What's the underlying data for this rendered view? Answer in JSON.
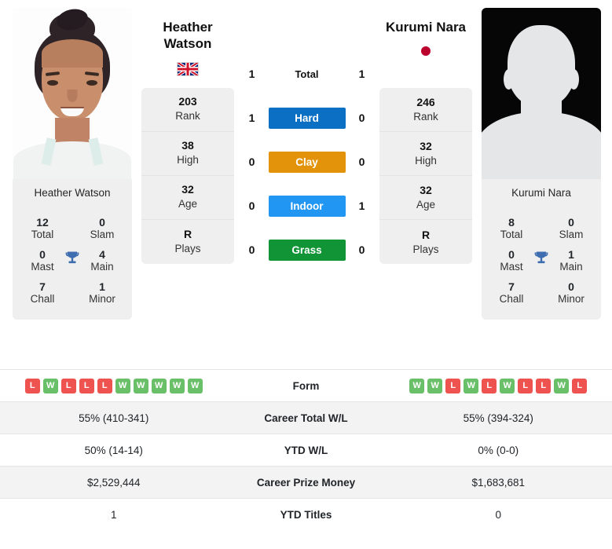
{
  "players": {
    "left": {
      "name": "Heather Watson",
      "name_line1": "Heather",
      "name_line2": "Watson",
      "photo_caption": "Heather Watson",
      "flag": "gb-flag-icon",
      "flag_country": "Great Britain",
      "stats": [
        {
          "value": "203",
          "label": "Rank"
        },
        {
          "value": "38",
          "label": "High"
        },
        {
          "value": "32",
          "label": "Age"
        },
        {
          "value": "R",
          "label": "Plays"
        }
      ],
      "titles": {
        "total": "12",
        "total_label": "Total",
        "slam": "0",
        "slam_label": "Slam",
        "mast": "0",
        "mast_label": "Mast",
        "main": "4",
        "main_label": "Main",
        "chall": "7",
        "chall_label": "Chall",
        "minor": "1",
        "minor_label": "Minor"
      },
      "form": [
        "L",
        "W",
        "L",
        "L",
        "L",
        "W",
        "W",
        "W",
        "W",
        "W"
      ],
      "career_total_wl": "55% (410-341)",
      "ytd_wl": "50% (14-14)",
      "career_prize_money": "$2,529,444",
      "ytd_titles": "1"
    },
    "right": {
      "name": "Kurumi Nara",
      "name_line1": "Kurumi Nara",
      "name_line2": "",
      "photo_caption": "Kurumi Nara",
      "flag": "jp-flag-icon",
      "flag_country": "Japan",
      "stats": [
        {
          "value": "246",
          "label": "Rank"
        },
        {
          "value": "32",
          "label": "High"
        },
        {
          "value": "32",
          "label": "Age"
        },
        {
          "value": "R",
          "label": "Plays"
        }
      ],
      "titles": {
        "total": "8",
        "total_label": "Total",
        "slam": "0",
        "slam_label": "Slam",
        "mast": "0",
        "mast_label": "Mast",
        "main": "1",
        "main_label": "Main",
        "chall": "7",
        "chall_label": "Chall",
        "minor": "0",
        "minor_label": "Minor"
      },
      "form": [
        "W",
        "W",
        "L",
        "W",
        "L",
        "W",
        "L",
        "L",
        "W",
        "L"
      ],
      "career_total_wl": "55% (394-324)",
      "ytd_wl": "0% (0-0)",
      "career_prize_money": "$1,683,681",
      "ytd_titles": "0"
    }
  },
  "head_to_head": [
    {
      "label": "Total",
      "left": "1",
      "right": "1",
      "badge": false,
      "color": ""
    },
    {
      "label": "Hard",
      "left": "1",
      "right": "0",
      "badge": true,
      "color": "#0b6fc4"
    },
    {
      "label": "Clay",
      "left": "0",
      "right": "0",
      "badge": true,
      "color": "#e2930a"
    },
    {
      "label": "Indoor",
      "left": "0",
      "right": "1",
      "badge": true,
      "color": "#2196f3"
    },
    {
      "label": "Grass",
      "left": "0",
      "right": "0",
      "badge": true,
      "color": "#109436"
    }
  ],
  "comparison_rows": [
    {
      "label": "Form",
      "left": "",
      "right": "",
      "type": "form"
    },
    {
      "label": "Career Total W/L",
      "left": "55% (410-341)",
      "right": "55% (394-324)",
      "type": "text"
    },
    {
      "label": "YTD W/L",
      "left": "50% (14-14)",
      "right": "0% (0-0)",
      "type": "text"
    },
    {
      "label": "Career Prize Money",
      "left": "$2,529,444",
      "right": "$1,683,681",
      "type": "text"
    },
    {
      "label": "YTD Titles",
      "left": "1",
      "right": "0",
      "type": "text"
    }
  ],
  "colors": {
    "hard": "#0b6fc4",
    "clay": "#e2930a",
    "indoor": "#2196f3",
    "grass": "#109436",
    "win": "#6abf69",
    "loss": "#ef5350",
    "trophy": "#3f6eb0",
    "panel": "#efefef",
    "row_alt": "#f3f3f3"
  },
  "icons": {
    "trophy": "trophy-icon"
  }
}
